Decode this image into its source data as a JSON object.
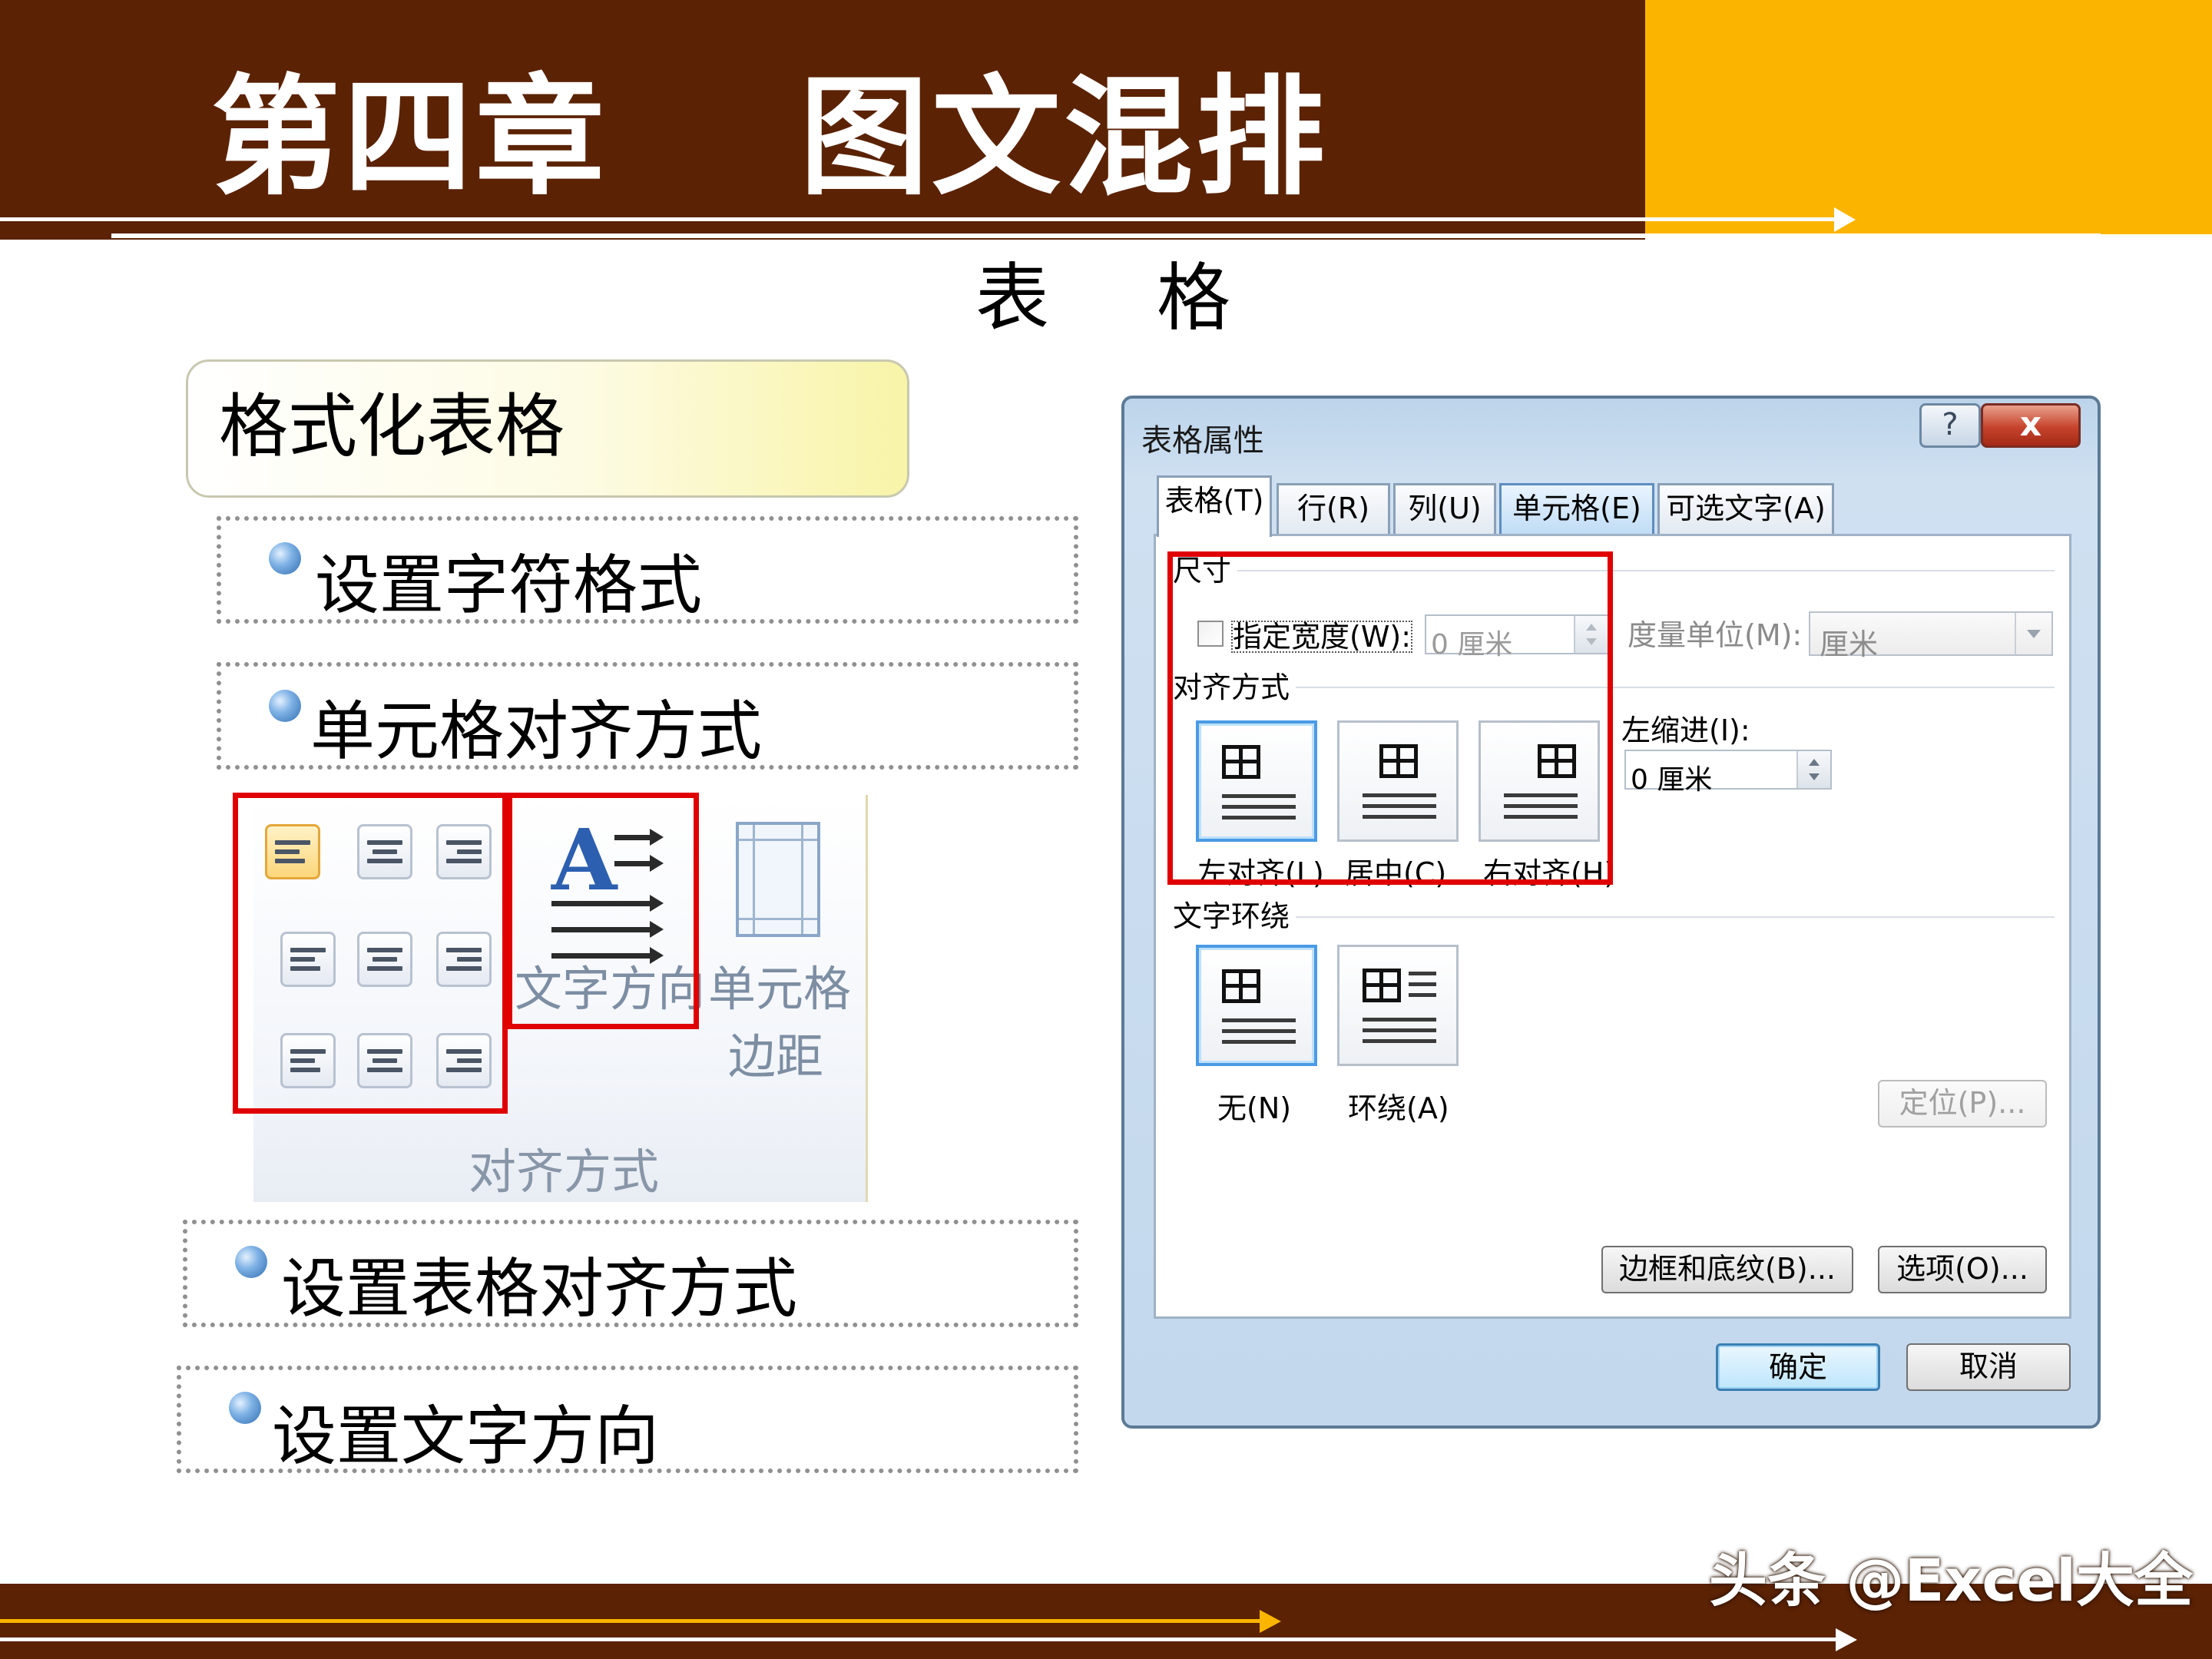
{
  "slide": {
    "chapter_title": "第四章    图文混排",
    "subtitle": "表格"
  },
  "left": {
    "format_box_label": "格式化表格",
    "bullets": [
      "设置字符格式",
      "单元格对齐方式",
      "设置表格对齐方式",
      "设置文字方向"
    ],
    "ribbon": {
      "text_direction_label": "文字方向",
      "cell_margin_label_1": "单元格",
      "cell_margin_label_2": "边距",
      "group_caption": "对齐方式"
    }
  },
  "dialog": {
    "title": "表格属性",
    "help_glyph": "?",
    "close_glyph": "x",
    "tabs": [
      "表格(T)",
      "行(R)",
      "列(U)",
      "单元格(E)",
      "可选文字(A)"
    ],
    "size_group": "尺寸",
    "specify_width_label": "指定宽度(W):",
    "width_value": "0 厘米",
    "measure_label": "度量单位(M):",
    "measure_value": "厘米",
    "alignment_group": "对齐方式",
    "indent_label": "左缩进(I):",
    "indent_value": "0 厘米",
    "align_options": [
      "左对齐(L)",
      "居中(C)",
      "右对齐(H)"
    ],
    "wrap_group": "文字环绕",
    "wrap_options": [
      "无(N)",
      "环绕(A)"
    ],
    "position_button": "定位(P)...",
    "borders_button": "边框和底纹(B)...",
    "options_button": "选项(O)...",
    "ok_button": "确定",
    "cancel_button": "取消"
  },
  "footer": {
    "watermark": "头条 @Excel大全"
  },
  "colors": {
    "header_brown": "#5b2204",
    "header_gold": "#fbb500",
    "highlight_red": "#e00000",
    "footer_arrow_gold": "#fbb500"
  }
}
